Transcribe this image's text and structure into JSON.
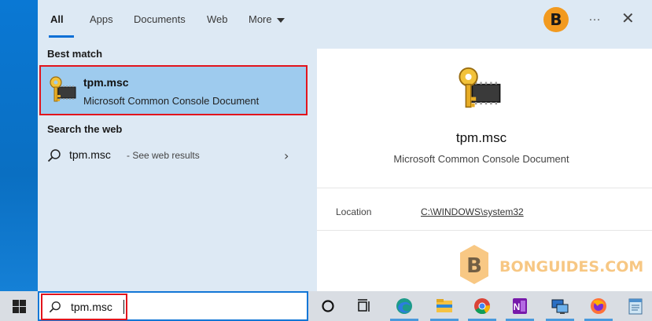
{
  "tabs": [
    {
      "label": "All",
      "active": true
    },
    {
      "label": "Apps"
    },
    {
      "label": "Documents"
    },
    {
      "label": "Web"
    },
    {
      "label": "More"
    }
  ],
  "header": {
    "avatar_letter": "B",
    "more_options": "…",
    "close": "✕"
  },
  "sections": {
    "best_match": "Best match",
    "search_web": "Search the web"
  },
  "best_match": {
    "title": "tpm.msc",
    "subtitle": "Microsoft Common Console Document",
    "icon": "mmc-key-chip-icon"
  },
  "web_result": {
    "term": "tpm.msc",
    "suffix": "- See web results",
    "chevron": "›"
  },
  "detail": {
    "title": "tpm.msc",
    "subtitle": "Microsoft Common Console Document",
    "location_label": "Location",
    "location_value": "C:\\WINDOWS\\system32"
  },
  "watermark": {
    "letter": "B",
    "text": "BONGUIDES.COM"
  },
  "search": {
    "value": "tpm.msc"
  },
  "taskbar": {
    "items": [
      "cortana-icon",
      "task-view-icon",
      "edge-icon",
      "file-explorer-icon",
      "chrome-icon",
      "onenote-icon",
      "remote-desktop-icon",
      "firefox-icon",
      "notepad-icon"
    ]
  },
  "colors": {
    "accent": "#0a6fd6",
    "highlight": "#e2141c",
    "selection": "#9ecbee",
    "panel": "#dde9f4"
  }
}
